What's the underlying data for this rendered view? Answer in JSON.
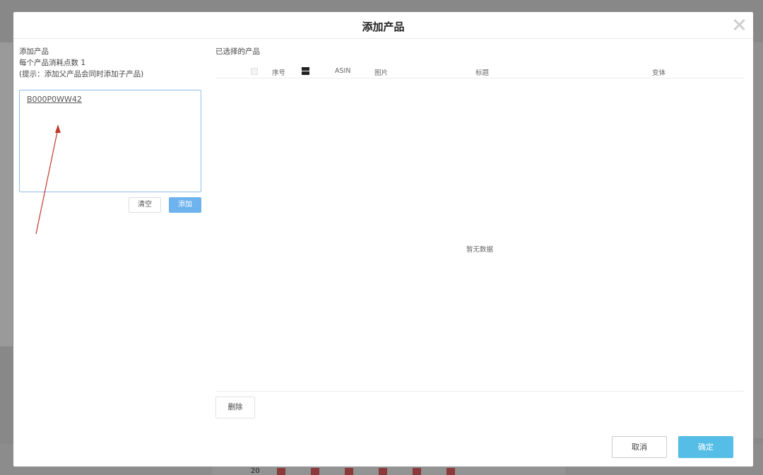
{
  "modal": {
    "title": "添加产品"
  },
  "left_panel": {
    "heading": "添加产品",
    "cost_line": "每个产品消耗点数 1",
    "hint": "(提示：添加父产品会同时添加子产品)",
    "asin_input_value": "B000P0WW42",
    "clear_label": "清空",
    "add_label": "添加"
  },
  "right_panel": {
    "title": "已选择的产品",
    "columns": [
      "序号",
      "ASIN",
      "图片",
      "标题",
      "变体"
    ],
    "empty_text": "暂无数据",
    "delete_label": "删除"
  },
  "footer": {
    "cancel_label": "取消",
    "ok_label": "确定"
  },
  "background": {
    "chart_tick": "20"
  },
  "colors": {
    "primary_button": "#55bde6",
    "add_button": "#6eb3ee",
    "annotation_arrow": "#c0392b"
  },
  "icons": {
    "close": "close-icon",
    "column_toggle": "column-toggle-icon"
  }
}
